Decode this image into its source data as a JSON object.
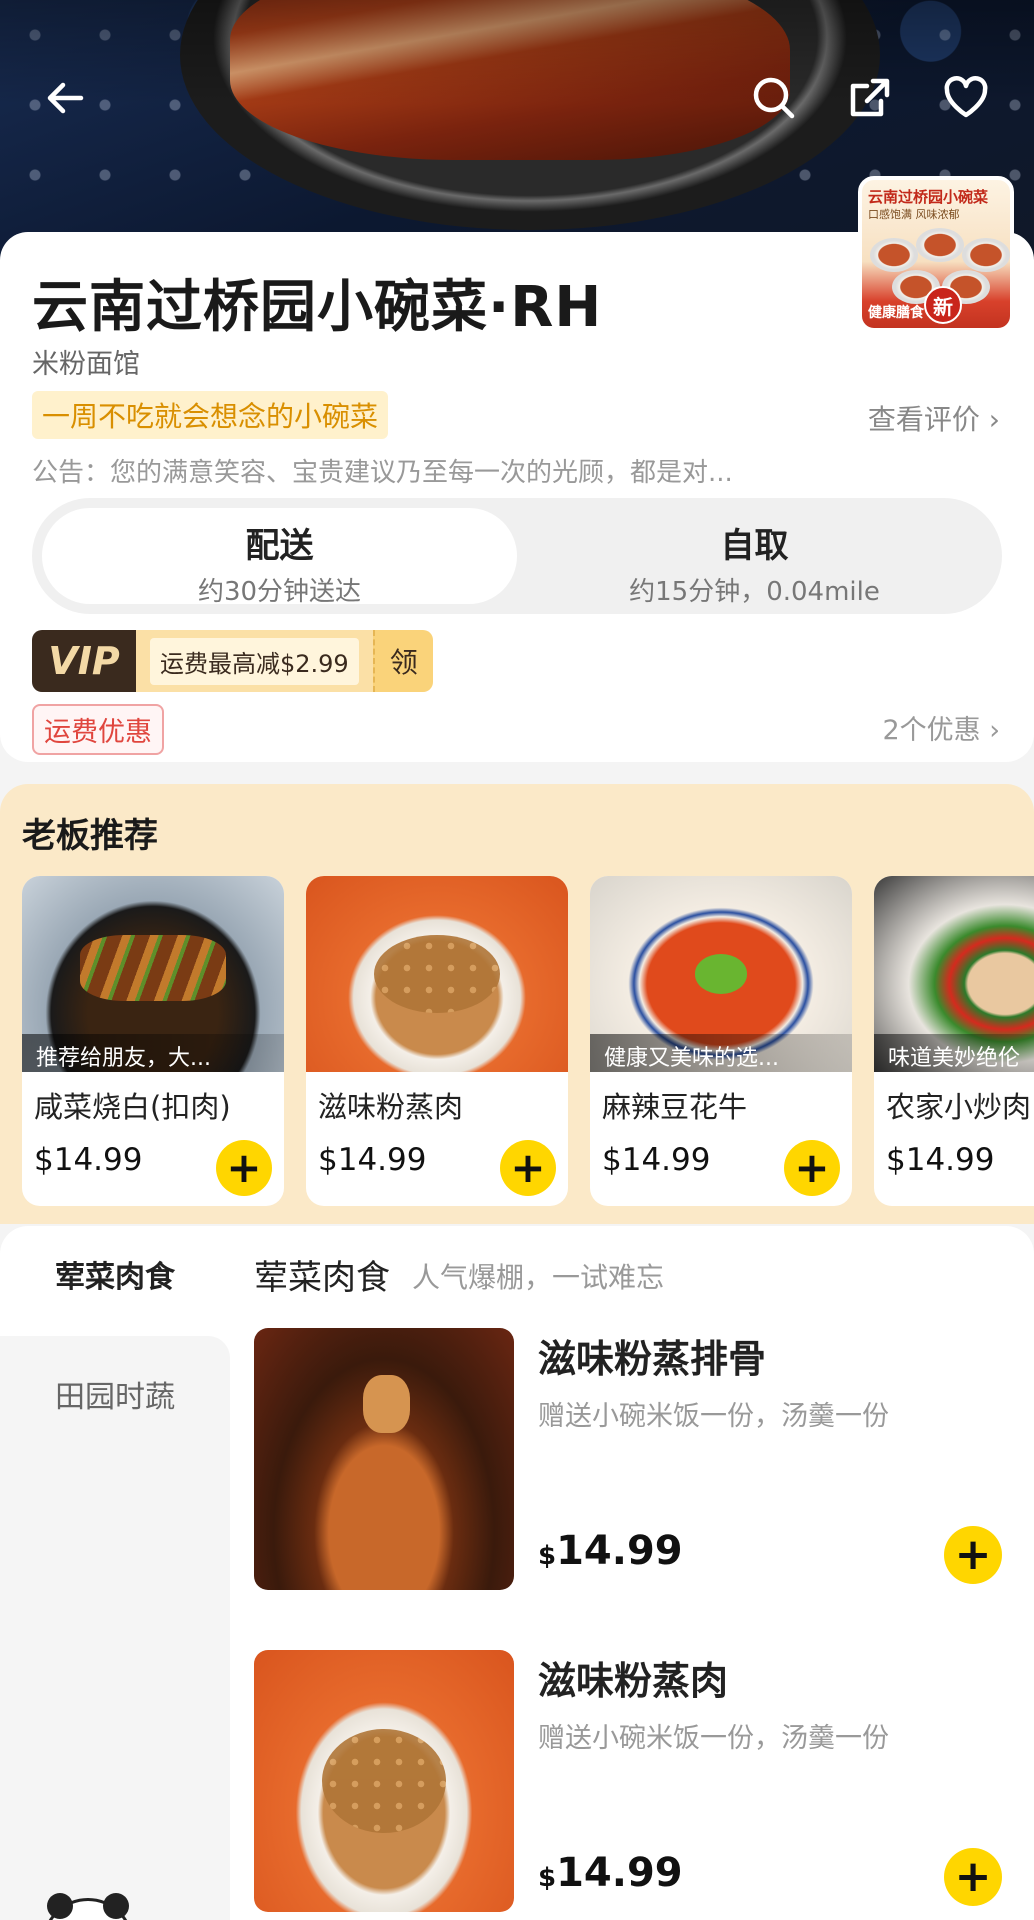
{
  "store": {
    "name": "云南过桥园小碗菜·RH",
    "category": "米粉面馆",
    "slogan": "一周不吃就会想念的小碗菜",
    "reviews_link": "查看评价 ›",
    "notice": "公告：您的满意笑容、宝贵建议乃至每一次的光顾，都是对...",
    "logo": {
      "title": "云南过桥园小碗菜",
      "sub": "口感饱满 风味浓郁",
      "bottom": "健康膳食",
      "badge": "新"
    }
  },
  "order_mode": {
    "delivery": {
      "title": "配送",
      "sub": "约30分钟送达"
    },
    "pickup": {
      "title": "自取",
      "sub": "约15分钟，0.04mile"
    }
  },
  "vip": {
    "logo": "VIP",
    "text": "运费最高减$2.99",
    "claim": "领"
  },
  "delivery_tag": "运费优惠",
  "promos_link": "2个优惠 ›",
  "boss": {
    "title": "老板推荐",
    "items": [
      {
        "caption": "推荐给朋友，大...",
        "name": "咸菜烧白(扣肉)",
        "price": "$14.99"
      },
      {
        "caption": "",
        "name": "滋味粉蒸肉",
        "price": "$14.99"
      },
      {
        "caption": "健康又美味的选...",
        "name": "麻辣豆花牛",
        "price": "$14.99"
      },
      {
        "caption": "味道美妙绝伦",
        "name": "农家小炒肉",
        "price": "$14.99"
      }
    ]
  },
  "menu": {
    "categories": [
      "荤菜肉食",
      "田园时蔬"
    ],
    "section_title": "荤菜肉食",
    "section_sub": "人气爆棚，一试难忘",
    "items": [
      {
        "name": "滋味粉蒸排骨",
        "desc": "赠送小碗米饭一份，汤羹一份",
        "currency": "$",
        "price": "14.99"
      },
      {
        "name": "滋味粉蒸肉",
        "desc": "赠送小碗米饭一份，汤羹一份",
        "currency": "$",
        "price": "14.99"
      }
    ]
  },
  "icons": [
    "back-arrow-icon",
    "search-icon",
    "share-icon",
    "heart-icon",
    "plus-icon"
  ],
  "colors": {
    "accent_yellow": "#ffd600",
    "boss_bg": "#fbe9c8",
    "promo_red": "#e0463e"
  }
}
